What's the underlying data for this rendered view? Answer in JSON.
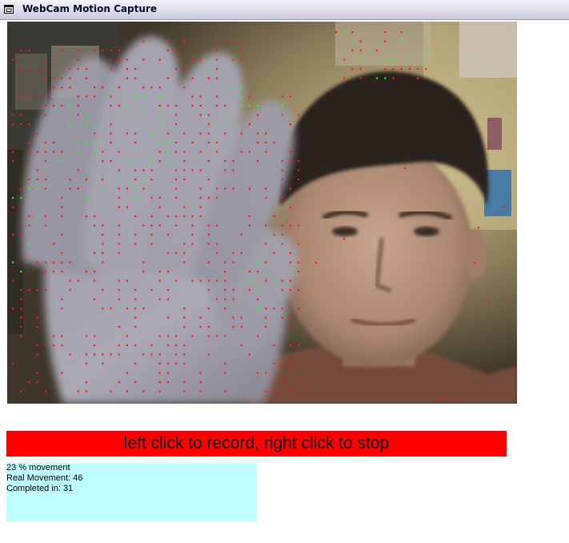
{
  "window": {
    "title": "WebCam Motion Capture"
  },
  "camera": {
    "view_icon": "webcam-feed",
    "marker_colors": {
      "motion": "#ff1a1a",
      "tracked": "#22ff22"
    }
  },
  "status_bar": {
    "text": "left click to record, right click to stop",
    "color": "#ff0000"
  },
  "stats": {
    "background": "#c0ffff",
    "movement_percent": "23",
    "movement_label": "% movement",
    "real_movement_label": "Real Movement:",
    "real_movement_value": "46",
    "completed_label": "Completed in:",
    "completed_value": "31"
  }
}
